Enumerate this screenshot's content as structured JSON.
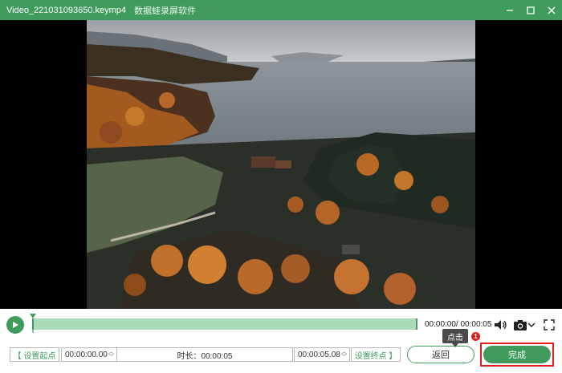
{
  "window": {
    "title": "Video_221031093650.keymp4",
    "app_name": "数据蛙录屏软件",
    "accent": "#3f9c5c"
  },
  "window_controls": {
    "minimize_icon": "minimize-icon",
    "maximize_icon": "maximize-icon",
    "close_icon": "close-icon"
  },
  "player": {
    "time_display": "00:00:00/ 00:00:05",
    "progress": 0.0
  },
  "trim": {
    "set_start_label": "【 设置起点",
    "start_time": "00:00:00.00",
    "duration_text": "时长：00:00:05",
    "end_time": "00:00:05.08",
    "set_end_label": "设置终点 】"
  },
  "actions": {
    "back_label": "返回",
    "done_label": "完成"
  },
  "annotation": {
    "tooltip": "点击",
    "badge": "1",
    "highlight_color": "#e02020"
  }
}
